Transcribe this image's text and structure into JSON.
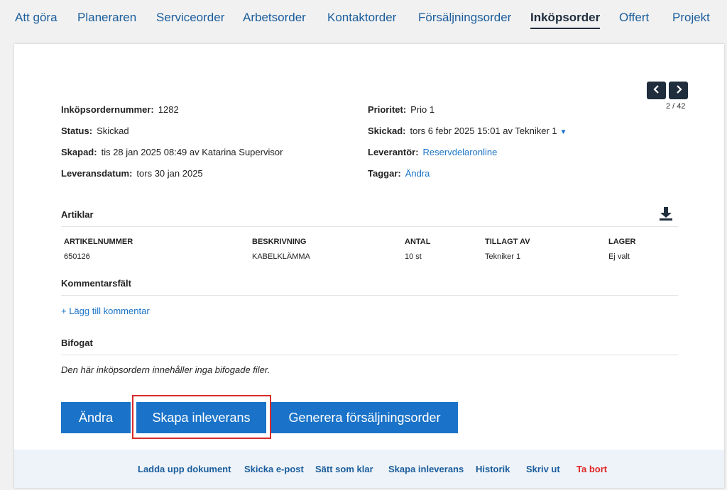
{
  "nav": {
    "items": [
      "Att göra",
      "Planeraren",
      "Serviceorder",
      "Arbetsorder",
      "Kontaktorder",
      "Försäljningsorder",
      "Inköpsorder",
      "Offert",
      "Projekt"
    ],
    "active": "Inköpsorder"
  },
  "pager": {
    "prev": "‹",
    "next": "›",
    "count": "2 / 42"
  },
  "order": {
    "number_label": "Inköpsordernummer:",
    "number": "1282",
    "status_label": "Status:",
    "status": "Skickad",
    "created_label": "Skapad:",
    "created": "tis 28 jan 2025 08:49 av Katarina Supervisor",
    "delivery_label": "Leveransdatum:",
    "delivery": "tors 30 jan 2025",
    "priority_label": "Prioritet:",
    "priority": "Prio 1",
    "sent_label": "Skickad:",
    "sent": "tors 6 febr 2025 15:01 av Tekniker 1",
    "supplier_label": "Leverantör:",
    "supplier": "Reservdelaronline",
    "tags_label": "Taggar:",
    "tags_link": "Ändra"
  },
  "articles": {
    "title": "Artiklar",
    "columns": [
      "ARTIKELNUMMER",
      "BESKRIVNING",
      "ANTAL",
      "TILLAGT AV",
      "LAGER"
    ],
    "rows": [
      {
        "article_no": "650126",
        "description": "KABELKLÄMMA",
        "quantity": "10 st",
        "added_by": "Tekniker 1",
        "stock": "Ej valt"
      }
    ]
  },
  "comments": {
    "title": "Kommentarsfält",
    "add_link": "+ Lägg till kommentar"
  },
  "attachments": {
    "title": "Bifogat",
    "empty_text": "Den här inköpsordern innehåller inga bifogade filer."
  },
  "buttons": {
    "edit": "Ändra",
    "create_delivery": "Skapa inleverans",
    "generate_sales_order": "Generera försäljningsorder"
  },
  "footer": {
    "upload": "Ladda upp dokument",
    "email": "Skicka e-post",
    "mark_done": "Sätt som klar",
    "create_delivery": "Skapa inleverans",
    "history": "Historik",
    "print": "Skriv ut",
    "delete": "Ta bort"
  },
  "colors": {
    "link": "#1a73c9",
    "primary_button": "#1a73c9",
    "dark": "#1f2d3d",
    "highlight": "#d92c2c",
    "danger": "#e02424",
    "footer_bg": "#eef3f9"
  },
  "icons": {
    "prev": "chevron-left-icon",
    "next": "chevron-right-icon",
    "download": "download-icon",
    "sent_dropdown": "caret-down-icon"
  }
}
